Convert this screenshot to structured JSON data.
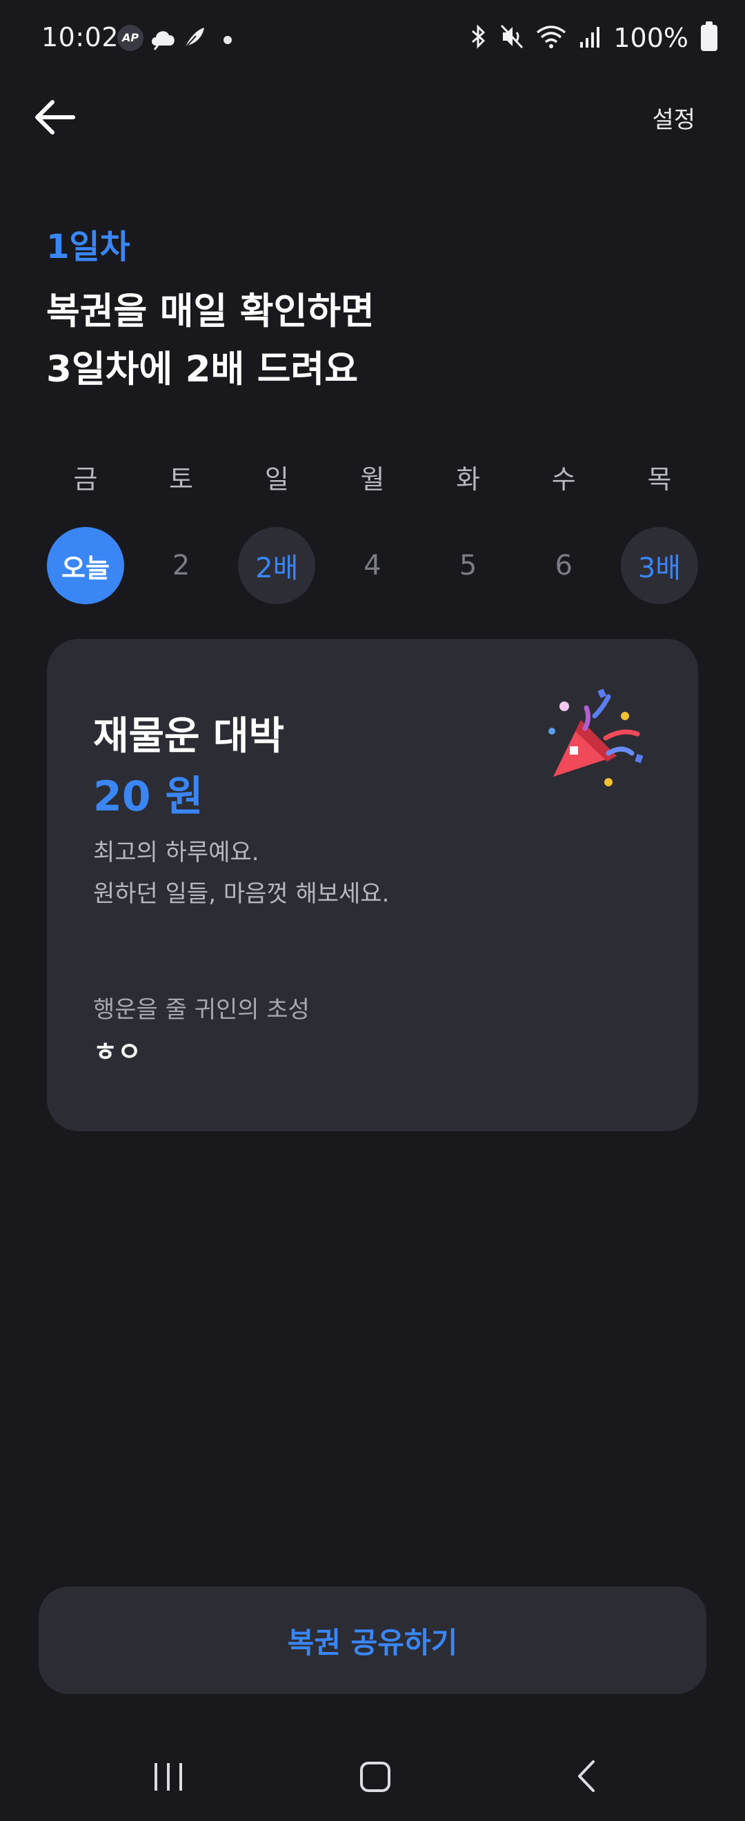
{
  "status_bar": {
    "time": "10:02",
    "notification_icons": [
      "ap-icon",
      "cloud-icon",
      "feather-icon"
    ],
    "battery": "100%"
  },
  "header": {
    "settings_label": "설정"
  },
  "intro": {
    "day_label": "1일차",
    "headline_line1": "복권을 매일 확인하면",
    "headline_line2": "3일차에 2배 드려요"
  },
  "week": {
    "days": [
      {
        "name": "금",
        "value": "오늘",
        "state": "today"
      },
      {
        "name": "토",
        "value": "2",
        "state": "normal"
      },
      {
        "name": "일",
        "value": "2배",
        "state": "bonus"
      },
      {
        "name": "월",
        "value": "4",
        "state": "normal"
      },
      {
        "name": "화",
        "value": "5",
        "state": "normal"
      },
      {
        "name": "수",
        "value": "6",
        "state": "normal"
      },
      {
        "name": "목",
        "value": "3배",
        "state": "bonus"
      }
    ]
  },
  "card": {
    "title": "재물운 대박",
    "amount": "20 원",
    "desc_line1": "최고의 하루예요.",
    "desc_line2": "원하던 일들, 마음껏 해보세요.",
    "sub_label": "행운을 줄 귀인의 초성",
    "sub_value": "ㅎㅇ",
    "icon": "party-popper-icon"
  },
  "share_button": {
    "label": "복권 공유하기"
  },
  "colors": {
    "accent": "#3a86f5",
    "background": "#18181d",
    "card": "#2c2c34"
  }
}
